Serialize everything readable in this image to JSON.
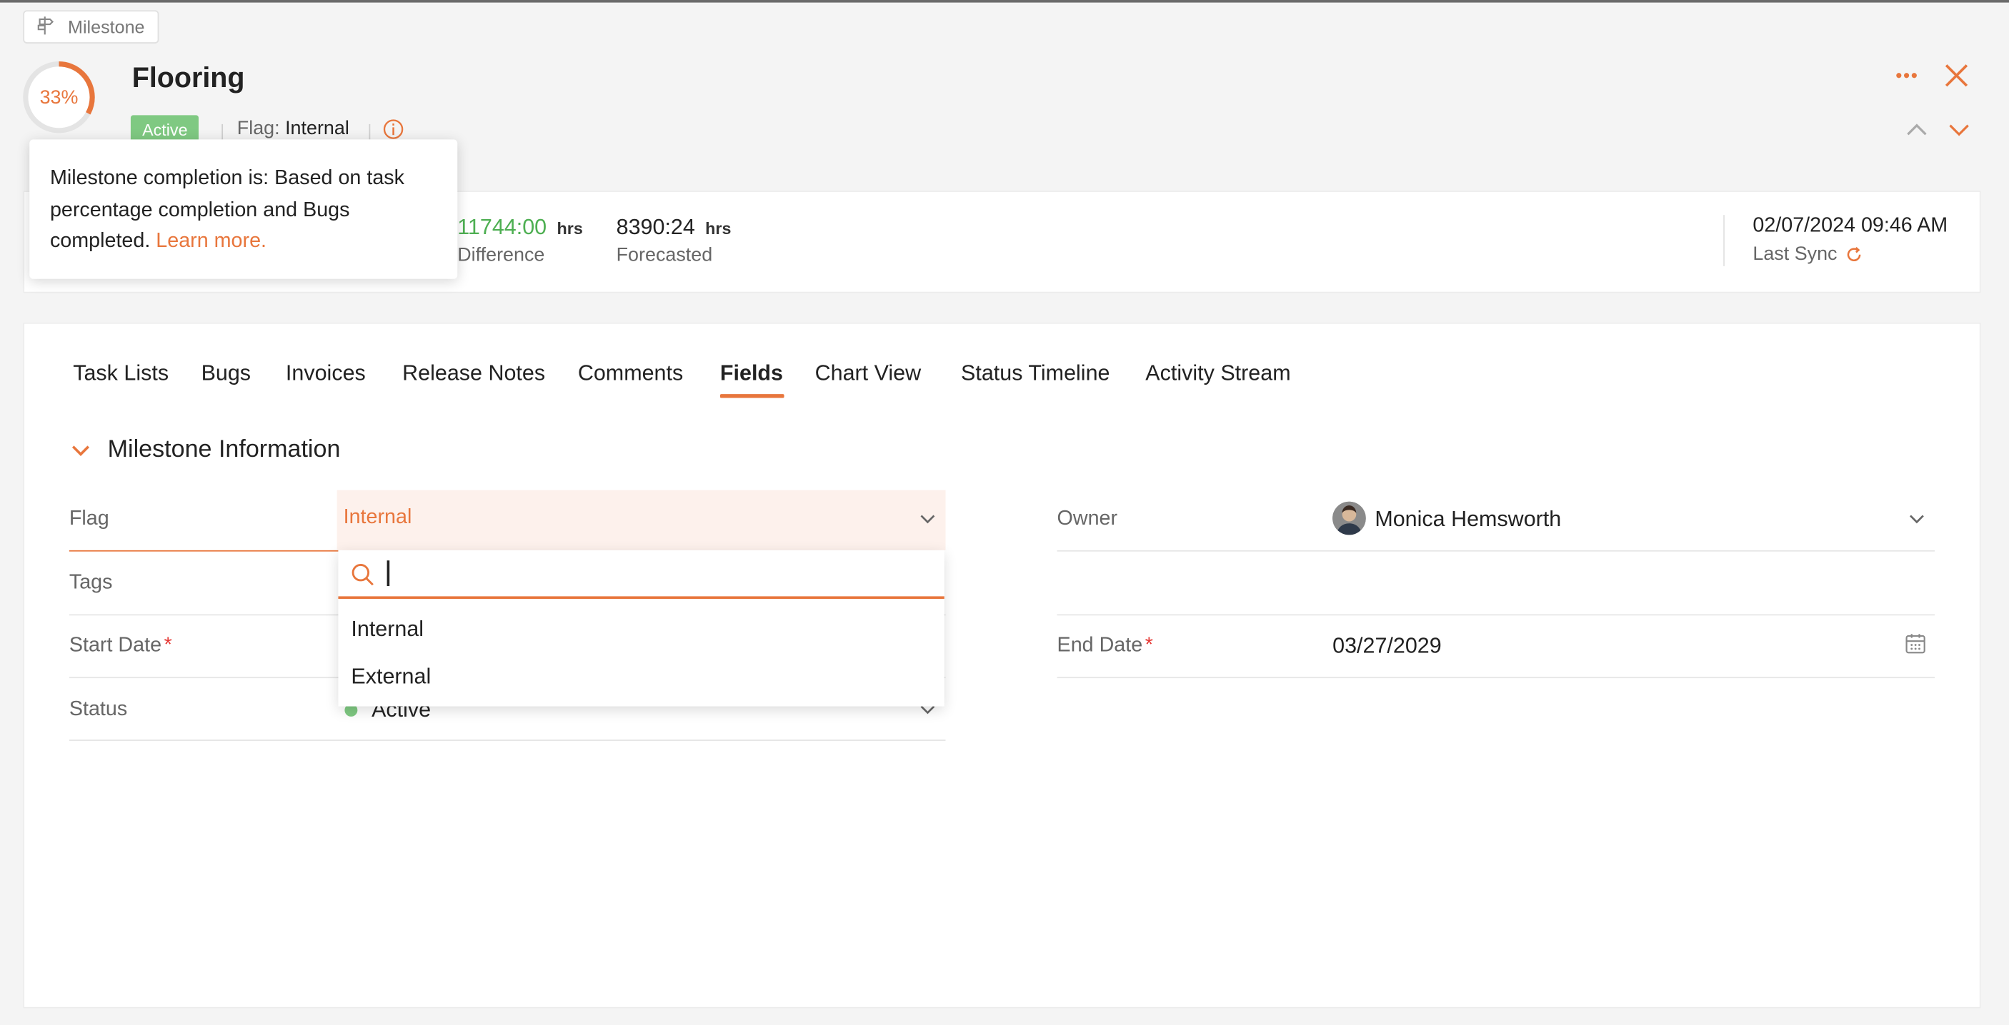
{
  "entity_chip": {
    "label": "Milestone",
    "icon": "signpost-icon"
  },
  "header": {
    "progress_text": "33%",
    "progress_percent": 33,
    "title": "Flooring",
    "status_badge": "Active",
    "flag_label": "Flag:",
    "flag_value": "Internal",
    "info_icon": "info-icon",
    "accent_color": "#e8763c",
    "active_color": "#7fc982"
  },
  "tooltip": {
    "text": "Milestone completion is: Based on task percentage completion and Bugs completed.",
    "link": "Learn more."
  },
  "summary": {
    "difference_value": "11744:00",
    "difference_unit": "hrs",
    "difference_label": "Difference",
    "forecast_value": "8390:24",
    "forecast_unit": "hrs",
    "forecast_label": "Forecasted",
    "last_sync_date": "02/07/2024 09:46 AM",
    "last_sync_label": "Last Sync"
  },
  "tabs": [
    {
      "label": "Task Lists"
    },
    {
      "label": "Bugs"
    },
    {
      "label": "Invoices"
    },
    {
      "label": "Release Notes"
    },
    {
      "label": "Comments"
    },
    {
      "label": "Fields",
      "active": true
    },
    {
      "label": "Chart View"
    },
    {
      "label": "Status Timeline"
    },
    {
      "label": "Activity Stream"
    }
  ],
  "section": {
    "title": "Milestone Information"
  },
  "fields": {
    "flag_label": "Flag",
    "flag_value": "Internal",
    "tags_label": "Tags",
    "start_date_label": "Start Date",
    "required_mark": "*",
    "status_label": "Status",
    "status_value": "Active",
    "owner_label": "Owner",
    "owner_value": "Monica Hemsworth",
    "end_date_label": "End Date",
    "end_date_value": "03/27/2029"
  },
  "dropdown": {
    "search_value": "",
    "options": [
      "Internal",
      "External"
    ]
  }
}
